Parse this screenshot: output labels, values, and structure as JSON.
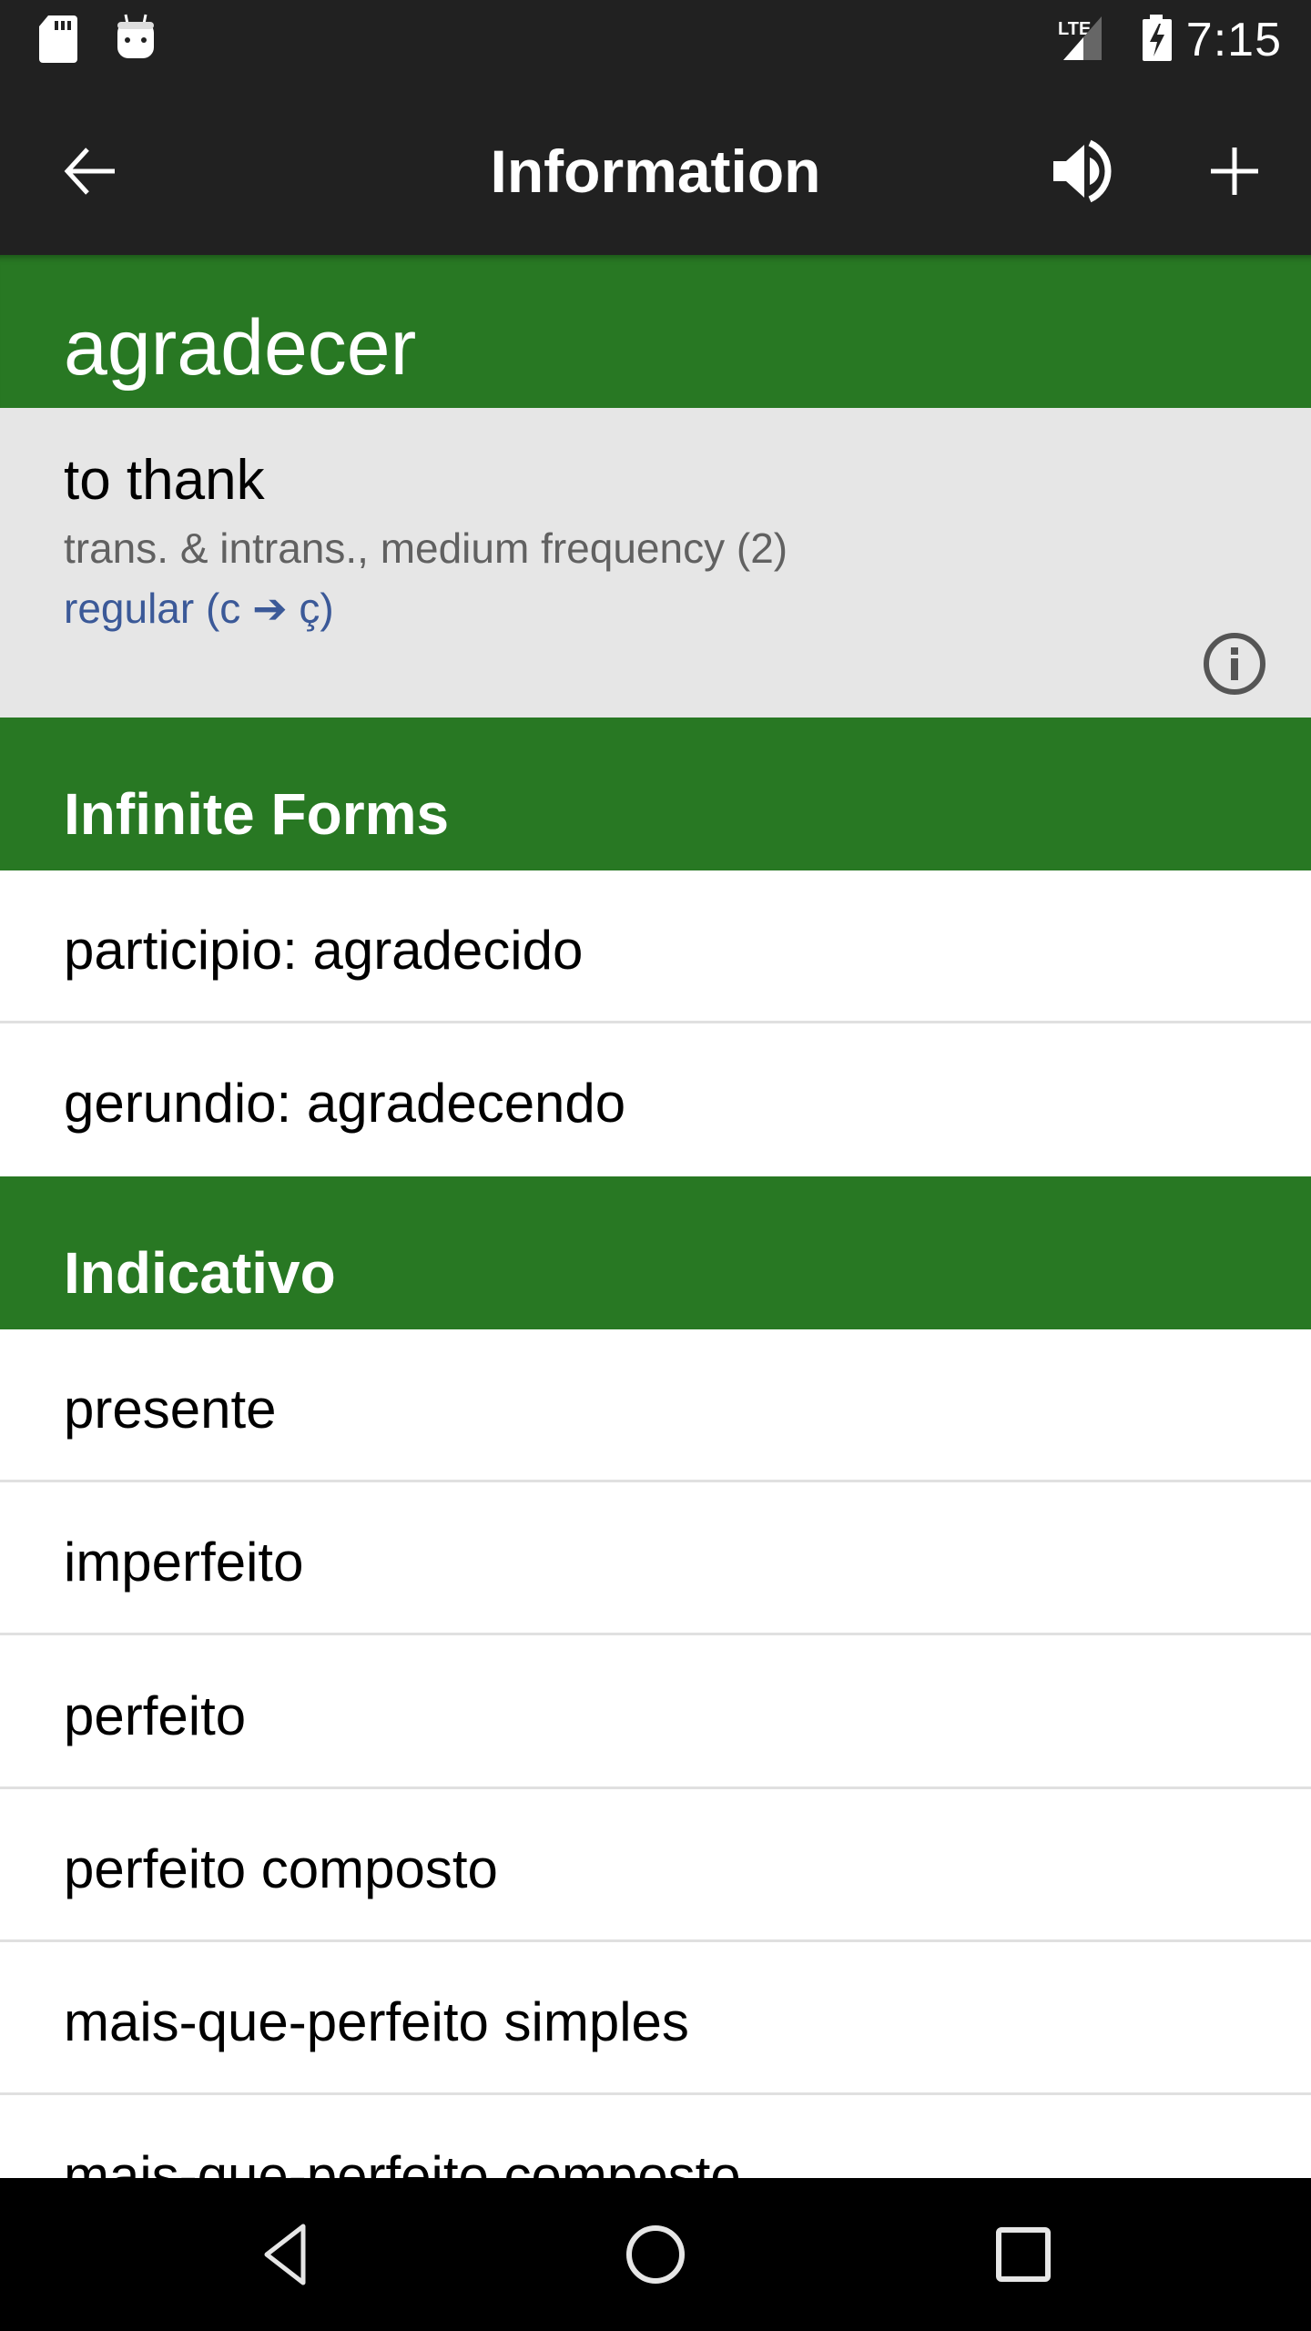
{
  "status_bar": {
    "time": "7:15",
    "network": "LTE",
    "icons": [
      "sd-card-icon",
      "android-icon",
      "lte-signal-icon",
      "battery-charging-icon"
    ]
  },
  "toolbar": {
    "title": "Information",
    "back_icon": "arrow-back-icon",
    "speaker_icon": "volume-icon",
    "add_icon": "plus-icon"
  },
  "word": {
    "headword": "agradecer",
    "translation": "to thank",
    "meta": "trans. & intrans., medium frequency (2)",
    "conjugation": "regular (c ➔ ç)",
    "info_icon": "info-icon"
  },
  "sections": [
    {
      "title": "Infinite Forms",
      "items": [
        "participio: agradecido",
        "gerundio: agradecendo"
      ]
    },
    {
      "title": "Indicativo",
      "items": [
        "presente",
        "imperfeito",
        "perfeito",
        "perfeito composto",
        "mais-que-perfeito simples",
        "mais-que-perfeito composto"
      ]
    }
  ],
  "nav_bar": {
    "back": "nav-back-icon",
    "home": "nav-home-icon",
    "recents": "nav-recents-icon"
  },
  "colors": {
    "accent_green": "#287823",
    "toolbar_dark": "#212121",
    "info_bg": "#e6e6e6",
    "link_blue": "#3b5998"
  }
}
